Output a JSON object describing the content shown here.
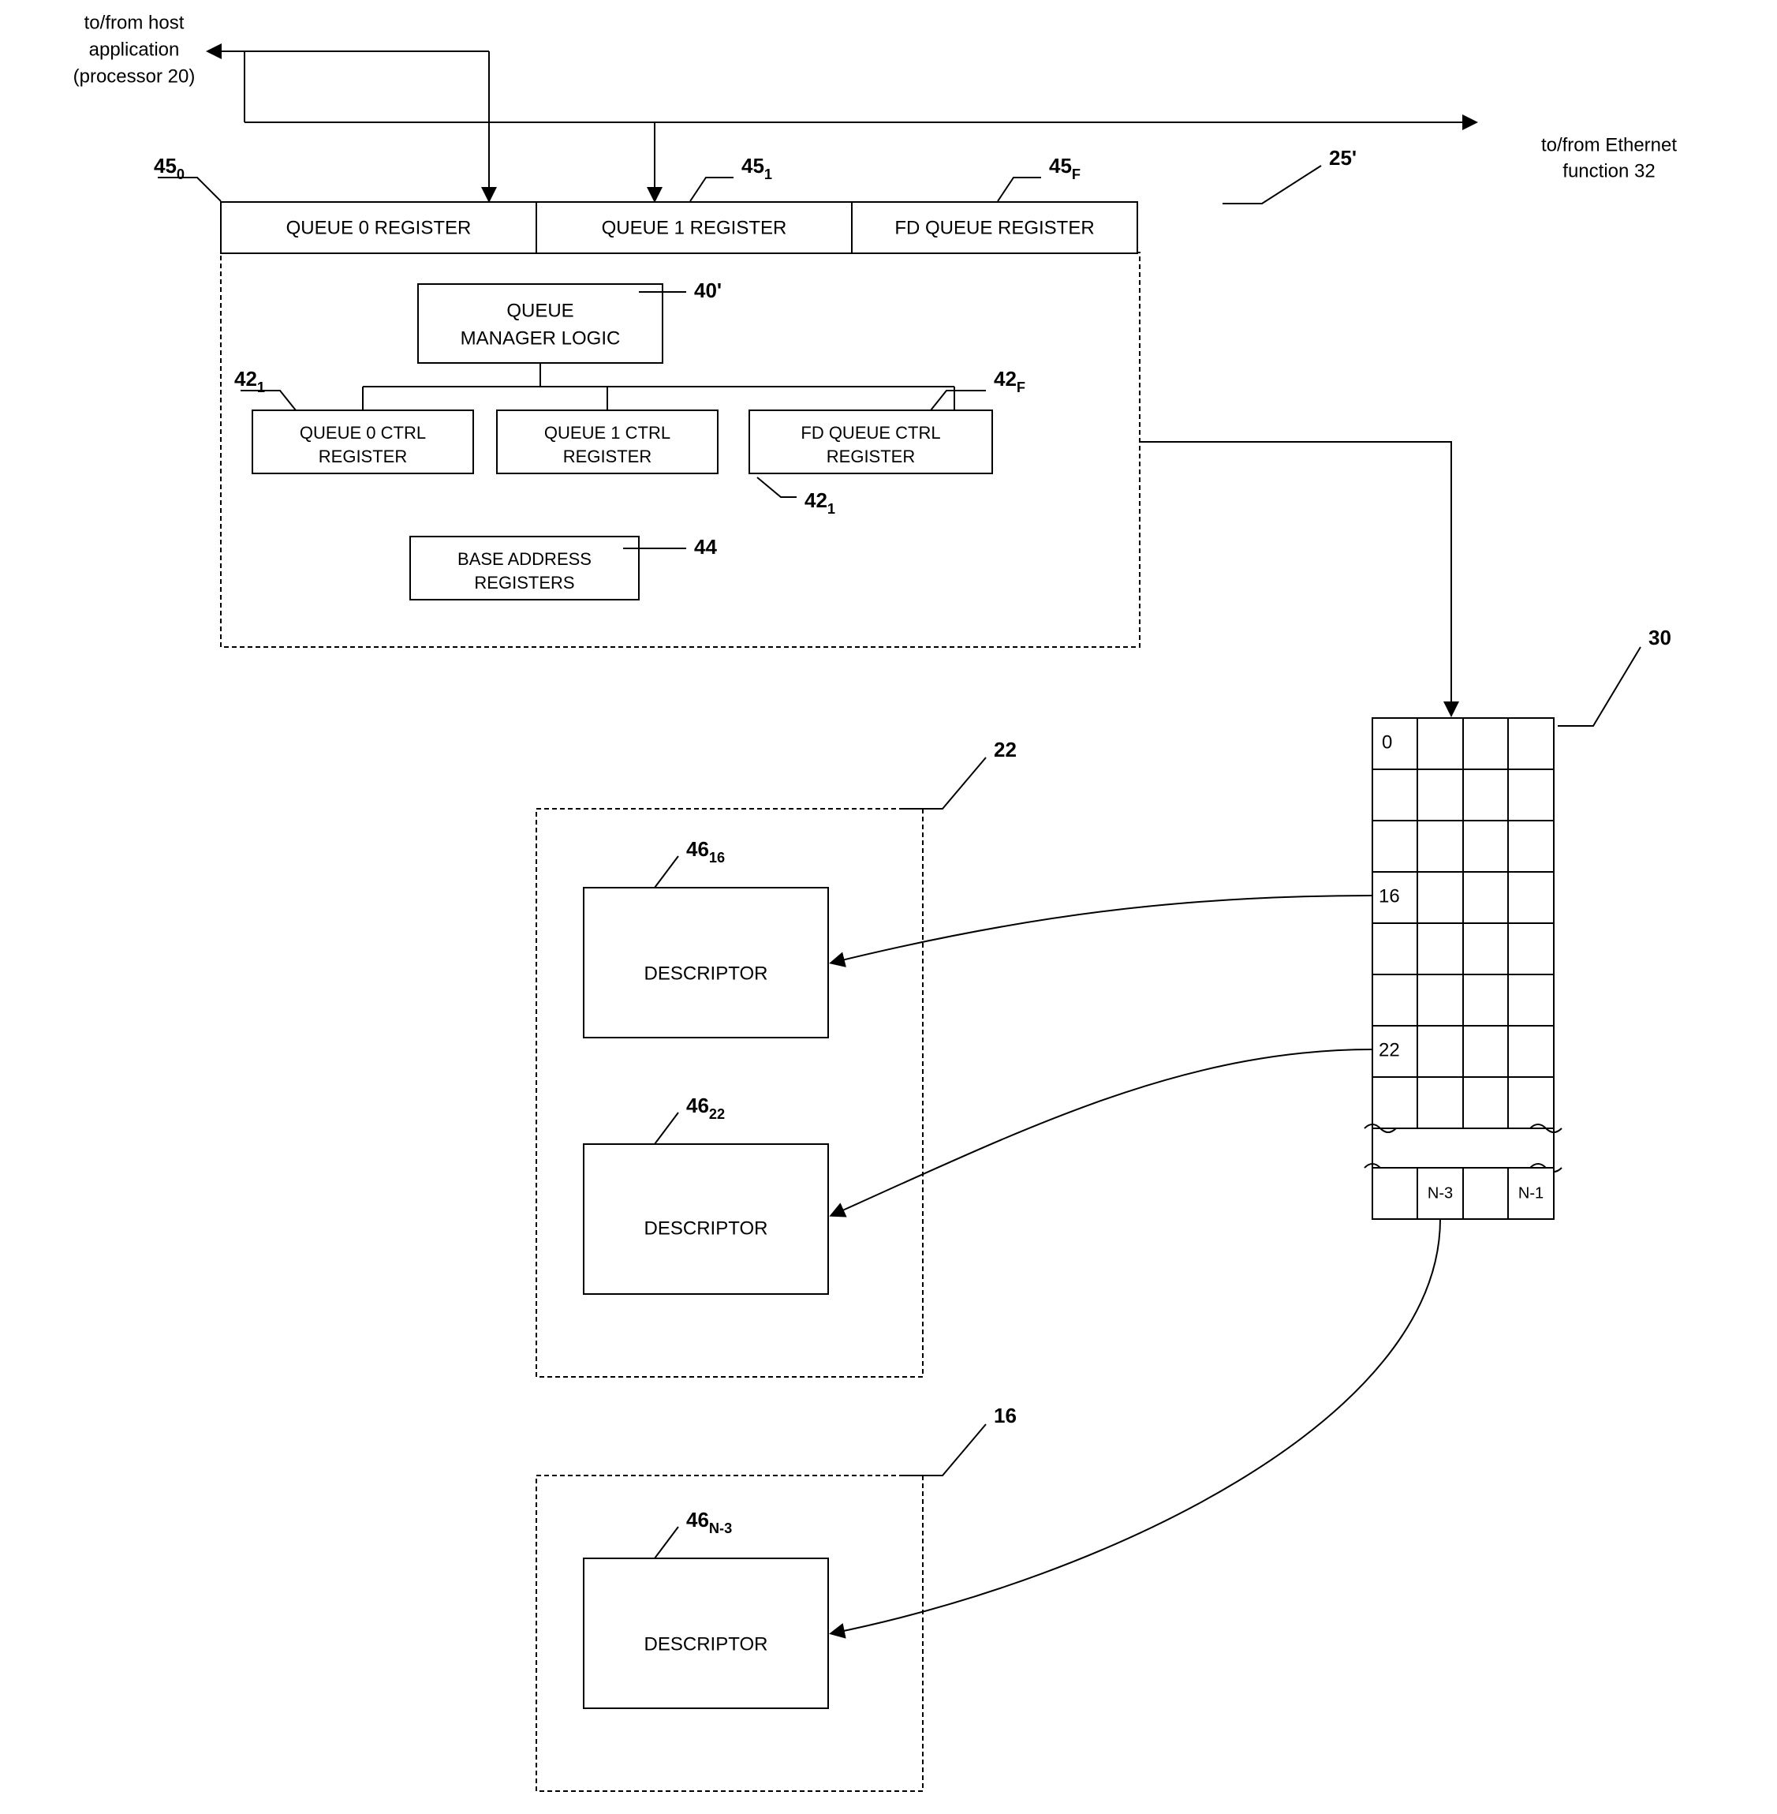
{
  "labels": {
    "host": {
      "line1": "to/from host",
      "line2": "application",
      "line3": "(processor 20)"
    },
    "ethernet": {
      "line1": "to/from Ethernet",
      "line2": "function 32"
    },
    "q0reg": "QUEUE 0 REGISTER",
    "q1reg": "QUEUE 1 REGISTER",
    "fdqreg": "FD QUEUE REGISTER",
    "qml": {
      "line1": "QUEUE",
      "line2": "MANAGER LOGIC"
    },
    "q0ctrl": {
      "line1": "QUEUE 0 CTRL",
      "line2": "REGISTER"
    },
    "q1ctrl": {
      "line1": "QUEUE 1 CTRL",
      "line2": "REGISTER"
    },
    "fdqctrl": {
      "line1": "FD QUEUE CTRL",
      "line2": "REGISTER"
    },
    "baseaddr": {
      "line1": "BASE ADDRESS",
      "line2": "REGISTERS"
    },
    "descriptor": "DESCRIPTOR"
  },
  "refs": {
    "r45_0": "45",
    "r45_0_sub": "0",
    "r45_1": "45",
    "r45_1_sub": "1",
    "r45_F": "45",
    "r45_F_sub": "F",
    "r25prime": "25'",
    "r40prime": "40'",
    "r42_1a": "42",
    "r42_1a_sub": "1",
    "r42_1b": "42",
    "r42_1b_sub": "1",
    "r42_F": "42",
    "r42_F_sub": "F",
    "r44": "44",
    "r30": "30",
    "r22": "22",
    "r16": "16",
    "r46_16": "46",
    "r46_16_sub": "16",
    "r46_22": "46",
    "r46_22_sub": "22",
    "r46_N3": "46",
    "r46_N3_sub": "N-3"
  },
  "grid": {
    "c0": "0",
    "c16": "16",
    "c22": "22",
    "cn3": "N-3",
    "cn1": "N-1"
  }
}
